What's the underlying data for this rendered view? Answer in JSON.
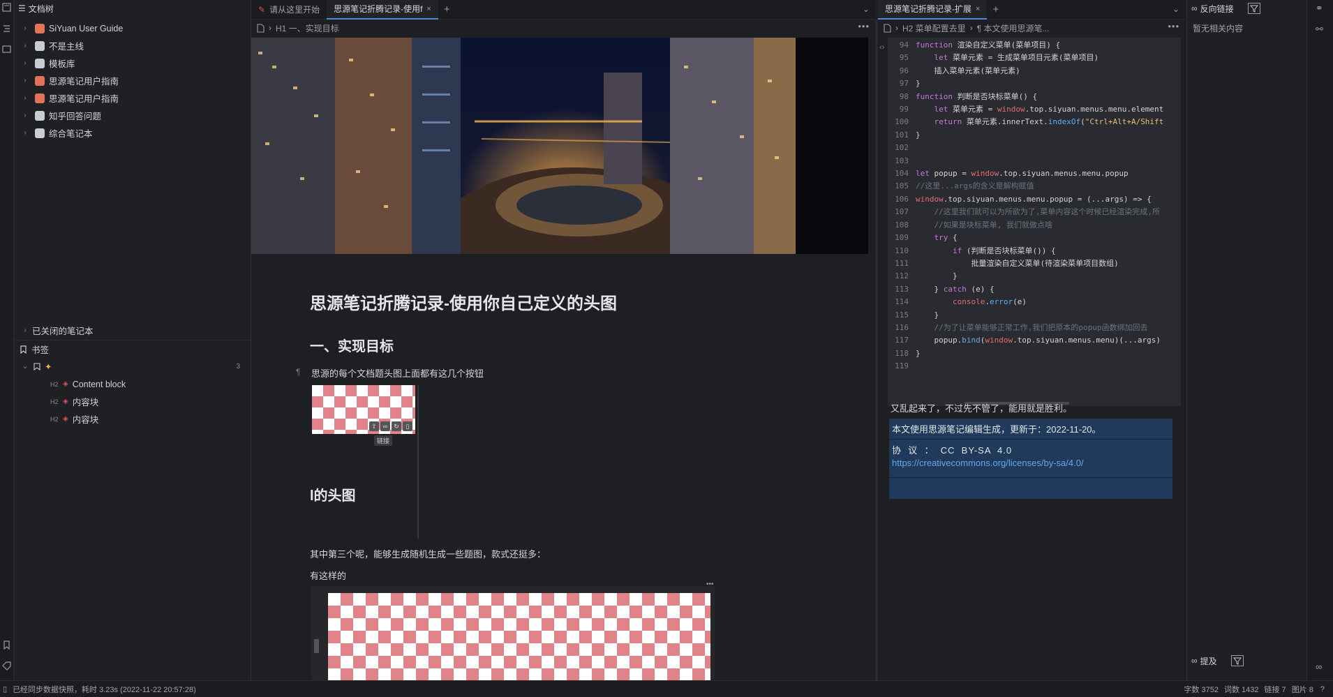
{
  "left_panel": {
    "title": "文档树",
    "notebooks": [
      {
        "label": "SiYuan User Guide",
        "color": "#e0735a"
      },
      {
        "label": "不是主线",
        "color": "#c9ccd2"
      },
      {
        "label": "模板库",
        "color": "#c9ccd2"
      },
      {
        "label": "思源笔记用户指南",
        "color": "#e0735a"
      },
      {
        "label": "思源笔记用户指南",
        "color": "#e0735a"
      },
      {
        "label": "知乎回答问题",
        "color": "#c9ccd2"
      },
      {
        "label": "综合笔记本",
        "color": "#c9ccd2"
      }
    ],
    "closed_notebooks": "已关闭的笔记本",
    "bookmarks_title": "书签",
    "bookmark_count": "3",
    "bookmark_items": [
      {
        "tag": "H2",
        "label": "Content block"
      },
      {
        "tag": "H2",
        "label": "内容块"
      },
      {
        "tag": "H2",
        "label": "内容块"
      }
    ]
  },
  "tabs1": [
    {
      "label": "请从这里开始",
      "active": false
    },
    {
      "label": "思源笔记折腾记录-使用f",
      "active": true
    }
  ],
  "tabs2": [
    {
      "label": "思源笔记折腾记录-扩展",
      "active": true
    }
  ],
  "editor1": {
    "breadcrumb": "H1 一、实现目标",
    "doc_title": "思源笔记折腾记录-使用你自己定义的头图",
    "h1": "一、实现目标",
    "para1": "思源的每个文档题头图上面都有这几个按钮",
    "tooltip": "链接",
    "partial_heading": "l的头图",
    "para2": "其中第三个呢，能够生成随机生成一些题图，款式还挺多：",
    "para3": "有这样的"
  },
  "editor2": {
    "breadcrumb_h2": "H2 菜单配置去里",
    "breadcrumb_p": "¶ 本文使用思源笔...",
    "code_lines": [
      {
        "n": "94",
        "html": "<span class=\"kw\">function</span> 渲染自定义菜单(菜单项目) {"
      },
      {
        "n": "95",
        "html": "    <span class=\"kw\">let</span> 菜单元素 = 生成菜单项目元素(菜单项目)"
      },
      {
        "n": "96",
        "html": "    插入菜单元素(菜单元素)"
      },
      {
        "n": "97",
        "html": "}"
      },
      {
        "n": "98",
        "html": "<span class=\"kw\">function</span> 判断是否块标菜单() {"
      },
      {
        "n": "99",
        "html": "    <span class=\"kw\">let</span> 菜单元素 = <span class=\"v\">window</span>.top.siyuan.menus.menu.element"
      },
      {
        "n": "100",
        "html": "    <span class=\"kw\">return</span> 菜单元素.innerText.<span class=\"f\">indexOf</span>(<span class=\"s\">\"Ctrl+Alt+A/Shift</span>"
      },
      {
        "n": "101",
        "html": "}"
      },
      {
        "n": "102",
        "html": ""
      },
      {
        "n": "103",
        "html": ""
      },
      {
        "n": "104",
        "html": "<span class=\"kw\">let</span> popup = <span class=\"v\">window</span>.top.siyuan.menus.menu.popup"
      },
      {
        "n": "105",
        "html": "<span class=\"c\">//这里...args的含义是解构赋值</span>"
      },
      {
        "n": "106",
        "html": "<span class=\"v\">window</span>.top.siyuan.menus.menu.popup = (...args) => {"
      },
      {
        "n": "107",
        "html": "    <span class=\"c\">//这里我们就可以为所欲为了,菜单内容这个时候已经渲染完成,所</span>"
      },
      {
        "n": "108",
        "html": "    <span class=\"c\">//如果是块标菜单, 我们就做点啥</span>"
      },
      {
        "n": "109",
        "html": "    <span class=\"kw\">try</span> {"
      },
      {
        "n": "110",
        "html": "        <span class=\"kw\">if</span> (判断是否块标菜单()) {"
      },
      {
        "n": "111",
        "html": "            批量渲染自定义菜单(待渲染菜单项目数组)"
      },
      {
        "n": "112",
        "html": "        }"
      },
      {
        "n": "113",
        "html": "    } <span class=\"kw\">catch</span> (e) {"
      },
      {
        "n": "114",
        "html": "        <span class=\"v\">console</span>.<span class=\"f\">error</span>(e)"
      },
      {
        "n": "115",
        "html": "    }"
      },
      {
        "n": "116",
        "html": "    <span class=\"c\">//为了让菜单能够正常工作,我们把原本的popup函数绑加回去</span>"
      },
      {
        "n": "117",
        "html": "    popup.<span class=\"f\">bind</span>(<span class=\"v\">window</span>.top.siyuan.menus.menu)(...args)"
      },
      {
        "n": "118",
        "html": "}"
      },
      {
        "n": "119",
        "html": ""
      }
    ],
    "para_after": "又乱起来了，不过先不管了，能用就是胜利。",
    "footer_line1": "本文使用思源笔记编辑生成，更新于：2022-11-20。",
    "license_label": "协  议  ：  CC  BY-SA  4.0",
    "license_link": "https://creativecommons.org/licenses/by-sa/4.0/"
  },
  "right_panel": {
    "backlinks_title": "反向链接",
    "empty_text": "暂无相关内容",
    "mentions_title": "提及"
  },
  "statusbar": {
    "left": "已经同步数据快照，耗时 3.23s (2022-11-22 20:57:28)",
    "chars": "字数 3752",
    "words": "词数 1432",
    "links": "链接 7",
    "images": "图片 8"
  },
  "colors": {
    "accent": "#4f8ad6",
    "bg": "#1e1f22",
    "code_bg": "#2a2b30",
    "footer_bg": "#1f3a5a"
  }
}
